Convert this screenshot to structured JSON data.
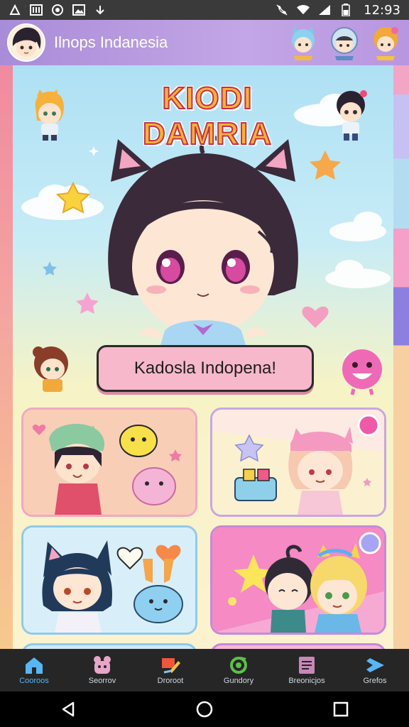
{
  "status_bar": {
    "time": "12:93",
    "left_icons": [
      "nfc-icon",
      "photo-icon",
      "record-icon",
      "image-icon",
      "download-icon"
    ],
    "right_icons": [
      "mute-icon",
      "wifi-icon",
      "signal-icon",
      "battery-icon"
    ]
  },
  "app_bar": {
    "title": "Ilnops Indanesia"
  },
  "hero": {
    "title": "KIODI DAMRIA",
    "button_label": "Kadosla Indopena!"
  },
  "bottom_nav": {
    "items": [
      {
        "label": "Cooroos",
        "icon": "home-icon"
      },
      {
        "label": "Seorrov",
        "icon": "character-icon"
      },
      {
        "label": "Droroot",
        "icon": "draw-icon"
      },
      {
        "label": "Gundory",
        "icon": "refresh-icon"
      },
      {
        "label": "Breonicjos",
        "icon": "book-icon"
      },
      {
        "label": "Grefos",
        "icon": "share-icon"
      }
    ]
  },
  "colors": {
    "app_bar": "#b896e0",
    "accent_active": "#58b6f5",
    "hero_button": "#f7b8cb",
    "nav_background": "#262626"
  }
}
